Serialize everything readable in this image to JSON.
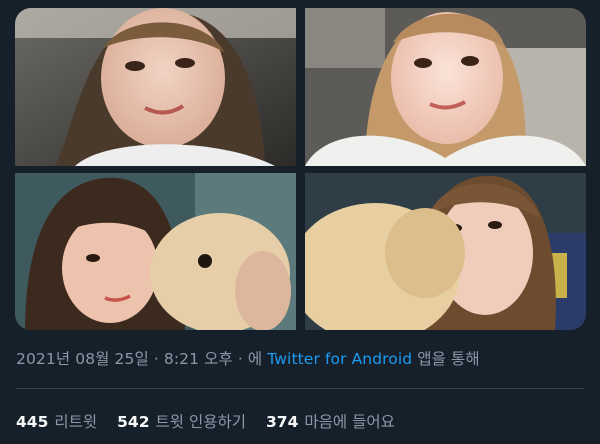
{
  "tweet": {
    "media": [
      {
        "alt": "selfie photo 1",
        "icon": "photo"
      },
      {
        "alt": "selfie photo 2",
        "icon": "photo"
      },
      {
        "alt": "photo with dog 1",
        "icon": "photo"
      },
      {
        "alt": "photo with dog 2",
        "icon": "photo"
      }
    ],
    "timestamp": {
      "date": "2021년 08월 25일",
      "separator": "·",
      "time": "8:21 오후",
      "prefix": "에",
      "source": "Twitter for Android",
      "suffix": "앱을 통해"
    },
    "stats": {
      "retweets": {
        "count": "445",
        "label": "리트윗"
      },
      "quote_tweets": {
        "count": "542",
        "label": "트윗 인용하기"
      },
      "likes": {
        "count": "374",
        "label": "마음에 들어요"
      }
    }
  },
  "colors": {
    "background": "#15202b",
    "link": "#1d9bf0",
    "muted_text": "#8b98a5",
    "primary_text": "#f7f9f9",
    "divider": "#38444d"
  }
}
